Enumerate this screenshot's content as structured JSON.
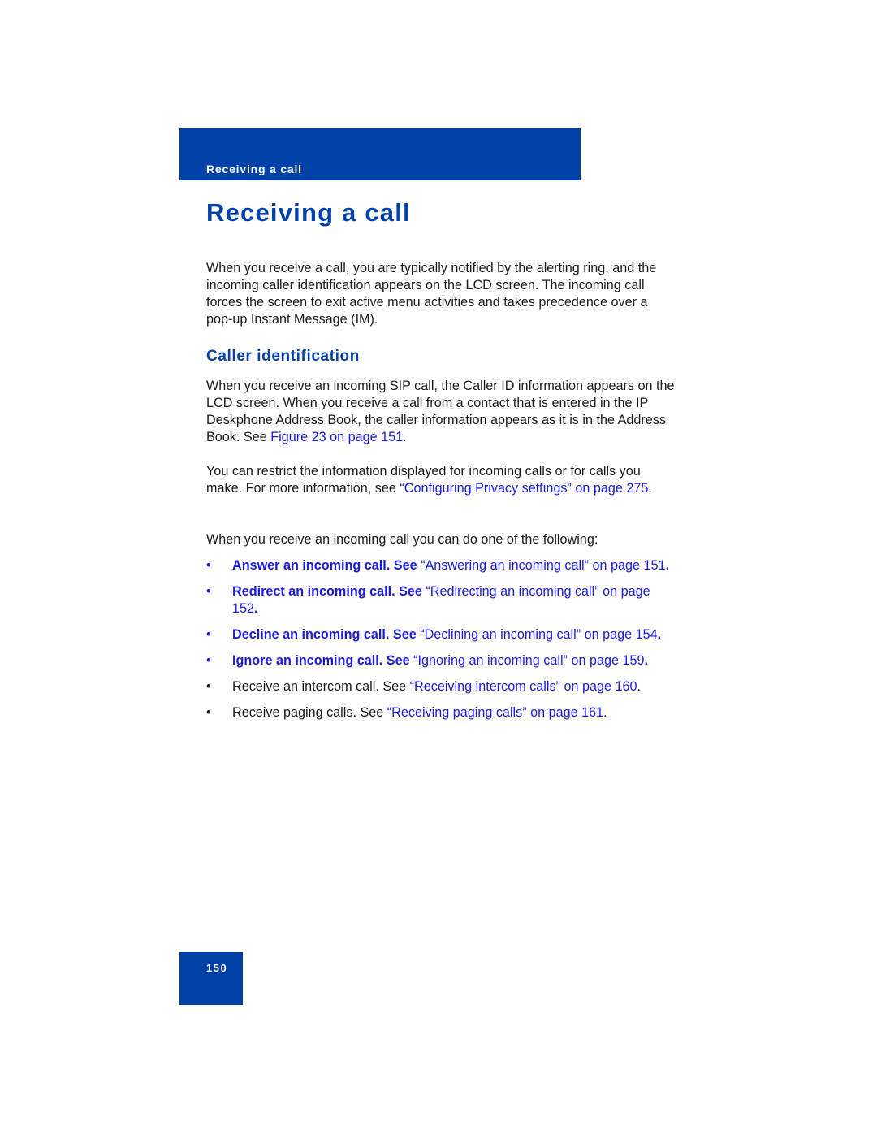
{
  "header": {
    "running_title": "Receiving a call"
  },
  "title": "Receiving a call",
  "intro": "When you receive a call, you are typically notified by the alerting ring, and the incoming caller identification appears on the LCD screen. The incoming call forces the screen to exit active menu activities and takes precedence over a pop-up Instant Message (IM).",
  "section": {
    "heading": "Caller identification",
    "para1": {
      "text": "When you receive an incoming SIP call, the Caller ID information appears on the LCD screen. When you receive a call from a contact that is entered in the IP Deskphone Address Book, the caller information appears as it is in the Address Book. See ",
      "link": "Figure 23 on page 151",
      "end": "."
    },
    "para2": {
      "text": "You can restrict the information displayed for incoming calls or for calls you make. For more information, see ",
      "link": "“Configuring Privacy settings” on page 275",
      "end": "."
    },
    "para3": "When you receive an incoming call you can do one of the following:"
  },
  "bullets": [
    {
      "bullet": "•",
      "lead": "Answer an incoming call. See ",
      "link": "“Answering an incoming call” on page 151",
      "end": "."
    },
    {
      "bullet": "•",
      "lead": "Redirect an incoming call. See ",
      "link": "“Redirecting an incoming call” on page 152",
      "end": "."
    },
    {
      "bullet": "•",
      "lead": "Decline an incoming call. See ",
      "link": "“Declining an incoming call” on page 154",
      "end": "."
    },
    {
      "bullet": "•",
      "lead": "Ignore an incoming call. See ",
      "link": "“Ignoring an incoming call” on page 159",
      "end": "."
    },
    {
      "bullet": "•",
      "lead": "Receive an intercom call. See ",
      "link": "“Receiving intercom calls” on page 160",
      "end": "."
    },
    {
      "bullet": "•",
      "lead": "Receive paging calls. See ",
      "link": "“Receiving paging calls” on page 161",
      "end": "."
    }
  ],
  "footer": {
    "page_number": "150"
  },
  "colors": {
    "brand_blue": "#0041a8",
    "link_blue": "#1a1ae0"
  }
}
